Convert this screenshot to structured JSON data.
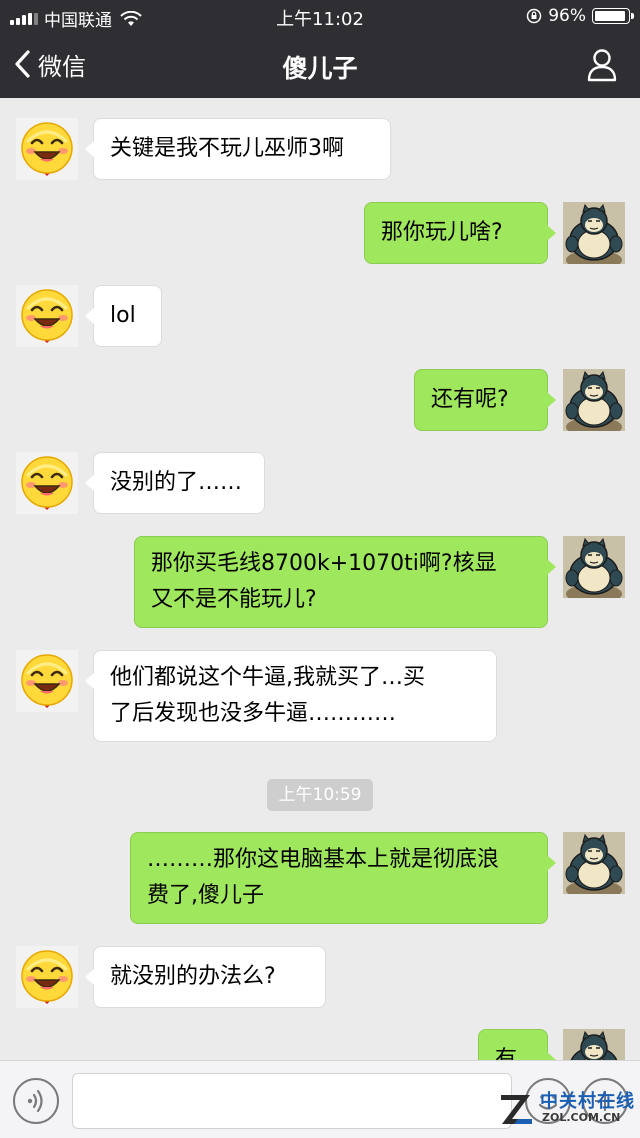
{
  "status_bar": {
    "carrier": "中国联通",
    "time": "上午11:02",
    "battery_percent": "96%",
    "battery_level": 0.96
  },
  "nav": {
    "back_label": "微信",
    "title": "傻儿子"
  },
  "messages": [
    {
      "side": "in",
      "lines": [
        "关键是我不玩儿巫师3啊"
      ]
    },
    {
      "side": "out",
      "lines": [
        "那你玩儿啥?"
      ]
    },
    {
      "side": "in",
      "lines": [
        "lol"
      ]
    },
    {
      "side": "out",
      "lines": [
        "还有呢?"
      ]
    },
    {
      "side": "in",
      "lines": [
        "没别的了……"
      ]
    },
    {
      "side": "out",
      "lines": [
        "那你买毛线8700k+1070ti啊?核显",
        "又不是不能玩儿?"
      ]
    },
    {
      "side": "in",
      "lines": [
        "他们都说这个牛逼,我就买了…买",
        "了后发现也没多牛逼…………"
      ]
    },
    {
      "side": "out",
      "lines": [
        "………那你这电脑基本上就是彻底浪",
        "费了,傻儿子"
      ]
    },
    {
      "side": "in",
      "lines": [
        "就没别的办法么?"
      ]
    },
    {
      "side": "out",
      "lines": [
        "有"
      ]
    }
  ],
  "timestamp": "上午10:59",
  "input": {
    "value": "",
    "placeholder": ""
  },
  "icons": {
    "back": "chevron-left-icon",
    "profile": "person-icon",
    "voice": "voice-icon",
    "emoji": "emoji-icon",
    "plus": "plus-icon"
  },
  "colors": {
    "topbar": "#2e2e33",
    "chat_background": "#ebebeb",
    "outgoing_bubble": "#9fe75c",
    "incoming_bubble": "#ffffff"
  },
  "watermark": {
    "line1": "中关村在线",
    "line2": "ZOL.COM.CN"
  }
}
